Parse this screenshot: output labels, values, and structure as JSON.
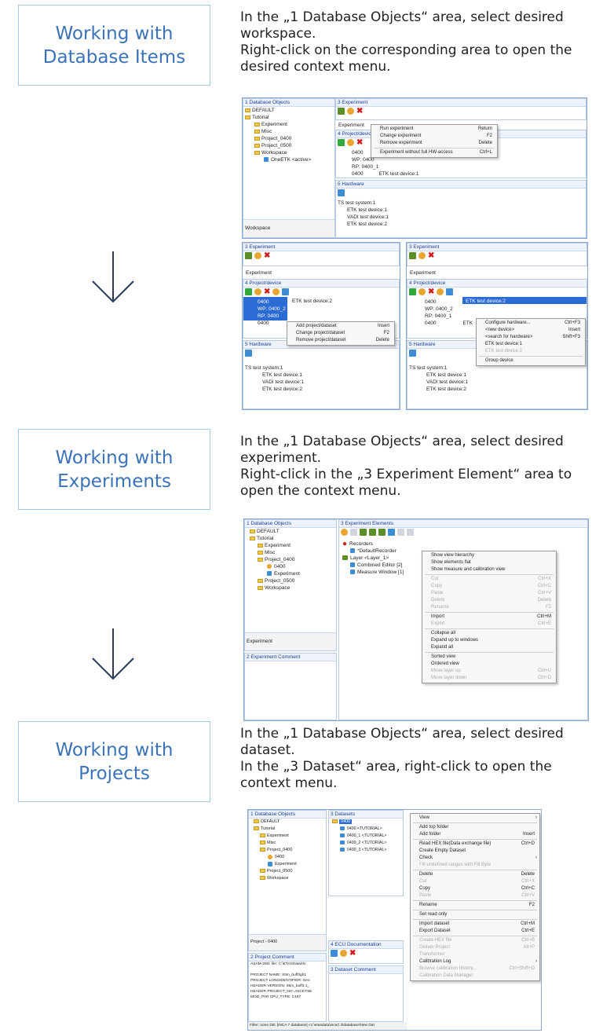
{
  "sections": [
    {
      "title": "Working with Database Items",
      "instructions": [
        "In the „1 Database Objects“ area, select desired workspace.",
        "Right-click on the corresponding area to open the desired context menu."
      ]
    },
    {
      "title": "Working with Experiments",
      "instructions": [
        "In the „1 Database Objects“ area, select desired experiment.",
        "Right-click in the „3 Experiment Element“ area to open the context menu."
      ]
    },
    {
      "title": "Working with Projects",
      "instructions": [
        "In the „1 Database Objects“ area, select desired dataset.",
        "In the „3 Dataset“ area, right-click to open the context menu."
      ]
    }
  ],
  "shot1": {
    "db_header": "1 Database Objects",
    "tree": [
      "DEFAULT",
      "Tutorial",
      "Experiment",
      "Misc",
      "Project_0400",
      "Project_0500",
      "Workspace",
      "OneETK <active>"
    ],
    "status": "Workspace",
    "exp_header": "3 Experiment",
    "exp_label": "Experiment",
    "proj_header": "4 Project/device",
    "proj_rows": [
      "0400",
      "WP: 0400",
      "RP: 0400_1",
      "0400"
    ],
    "device": "ETK test device:1",
    "hw_header": "5 Hardware",
    "hw_tree": [
      "TS test system:1",
      "ETK test device:1",
      "VADI test device:1",
      "ETK test device:2"
    ],
    "menu": [
      {
        "label": "Run experiment",
        "key": "Return"
      },
      {
        "label": "Change experiment",
        "key": "F2"
      },
      {
        "label": "Remove experiment",
        "key": "Delete"
      },
      {
        "label": "Experiment without full HW-access",
        "key": "Ctrl+L"
      }
    ]
  },
  "shot2": {
    "exp_header": "3 Experiment",
    "exp_label": "Experiment",
    "proj_header": "4 Project/device",
    "proj_rows": [
      "0400",
      "WP: 0400_2",
      "RP: 0400",
      "0400"
    ],
    "device": "ETK test device:2",
    "hw_header": "5 Hardware",
    "hw_tree": [
      "TS test system:1",
      "ETK test device:1",
      "VADI test device:1",
      "ETK test device:2"
    ],
    "menu": [
      {
        "label": "Add project/dataset",
        "key": "Insert"
      },
      {
        "label": "Change project/dataset",
        "key": "F2"
      },
      {
        "label": "Remove project/dataset",
        "key": "Delete"
      }
    ]
  },
  "shot3": {
    "exp_header": "3 Experiment",
    "exp_label": "Experiment",
    "proj_header": "4 Project/device",
    "proj_rows": [
      "0400",
      "WP: 0400_2",
      "RP: 0400_1",
      "0400"
    ],
    "device": "ETK test device:2",
    "device2": "ETK",
    "hw_header": "5 Hardware",
    "hw_tree": [
      "TS test system:1",
      "ETK test device:1",
      "VADI test device:1",
      "ETK test device:2"
    ],
    "menu": [
      {
        "label": "Configure hardware...",
        "key": "Ctrl+F3"
      },
      {
        "label": "<new device>",
        "key": "Insert"
      },
      {
        "label": "<search for hardware>",
        "key": "Shift+F3"
      },
      {
        "label": "ETK test device:1",
        "key": ""
      },
      {
        "label": "ETK test device:2",
        "key": ""
      },
      {
        "label": "Group device",
        "key": ""
      }
    ]
  },
  "shot4": {
    "db_header": "1 Database Objects",
    "tree": [
      "DEFAULT",
      "Tutorial",
      "Experiment",
      "Misc",
      "Project_0400",
      "0400",
      "Experiment",
      "Project_0500",
      "Workspace"
    ],
    "status": "Experiment",
    "comment_header": "2 Experiment Comment",
    "elem_header": "3 Experiment Elements",
    "elem_tree": [
      "Recorders",
      "*DefaultRecorder",
      "Layer <Layer_1>",
      "Combined Editor [2]",
      "Measure Window [1]"
    ],
    "menu": [
      {
        "label": "Show view hierarchy",
        "key": ""
      },
      {
        "label": "Show elements flat",
        "key": ""
      },
      {
        "label": "Show measure and calibration view",
        "key": ""
      },
      {
        "label": "Cut",
        "key": "Ctrl+X"
      },
      {
        "label": "Copy",
        "key": "Ctrl+C"
      },
      {
        "label": "Paste",
        "key": "Ctrl+V"
      },
      {
        "label": "Delete",
        "key": "Delete"
      },
      {
        "label": "Rename",
        "key": "F2"
      },
      {
        "label": "Import",
        "key": "Ctrl+M"
      },
      {
        "label": "Export",
        "key": "Ctrl+E"
      },
      {
        "label": "Collapse all",
        "key": ""
      },
      {
        "label": "Expand up to windows",
        "key": ""
      },
      {
        "label": "Expand all",
        "key": ""
      },
      {
        "label": "Sorted view",
        "key": ""
      },
      {
        "label": "Ordered view",
        "key": ""
      },
      {
        "label": "Move layer up",
        "key": "Ctrl+U"
      },
      {
        "label": "Move layer down",
        "key": "Ctrl+D"
      }
    ]
  },
  "shot5": {
    "db_header": "1 Database Objects",
    "tree": [
      "DEFAULT",
      "Tutorial",
      "Experiment",
      "Misc",
      "Project_0400",
      "0400",
      "Experiment",
      "Project_0500",
      "Workspace"
    ],
    "status": "Project - 0400",
    "comment_header": "2 Project Comment",
    "comment_lines": [
      "ASAM-2MC file: C:\\ETASData\\IN",
      "",
      "PROJECT NAME: Stim_buff3gh1",
      "PROJECT LONGIDENTIFIER: Gen",
      "HEADER VERSION: Stim_buff3.1_",
      "HEADER PROJECT_NO: ASCETSE",
      "MOD_PAR CPU_TYPE: C167"
    ],
    "filter": "Filter: none   DB: [INCA 7 database] <c:\\etasdata\\inca7.3\\database\\New Dat",
    "ds_header": "3 Datasets",
    "ds_tree": [
      "0400",
      "0400 <TUTORIAL>",
      "0400_1 <TUTORIAL>",
      "0400_2 <TUTORIAL>",
      "0400_3 <TUTORIAL>"
    ],
    "ecu_header": "4 ECU Documentation",
    "dsc_header": "3 Dataset Comment",
    "menu": [
      {
        "label": "View",
        "key": ""
      },
      {
        "label": "Add top folder",
        "key": ""
      },
      {
        "label": "Add folder",
        "key": "Insert"
      },
      {
        "label": "Read HEX file(Data exchange file)",
        "key": "Ctrl+D"
      },
      {
        "label": "Create Empty Dataset",
        "key": ""
      },
      {
        "label": "Check",
        "key": ""
      },
      {
        "label": "Fill undefined ranges with Fill Byte",
        "key": ""
      },
      {
        "label": "Delete",
        "key": "Delete"
      },
      {
        "label": "Cut",
        "key": "Ctrl+X"
      },
      {
        "label": "Copy",
        "key": "Ctrl+C"
      },
      {
        "label": "Paste",
        "key": "Ctrl+V"
      },
      {
        "label": "Rename",
        "key": "F2"
      },
      {
        "label": "Set read only",
        "key": ""
      },
      {
        "label": "Import dataset",
        "key": "Ctrl+M"
      },
      {
        "label": "Export Dataset",
        "key": "Ctrl+E"
      },
      {
        "label": "Create HEX file",
        "key": "Ctrl+B"
      },
      {
        "label": "Deliver Project",
        "key": "Alt+P"
      },
      {
        "label": "Transformer",
        "key": ""
      },
      {
        "label": "Calibration Log",
        "key": ""
      },
      {
        "label": "Browse calibration history...",
        "key": "Ctrl+Shift+D"
      },
      {
        "label": "Calibration Data Manager",
        "key": ""
      }
    ]
  }
}
